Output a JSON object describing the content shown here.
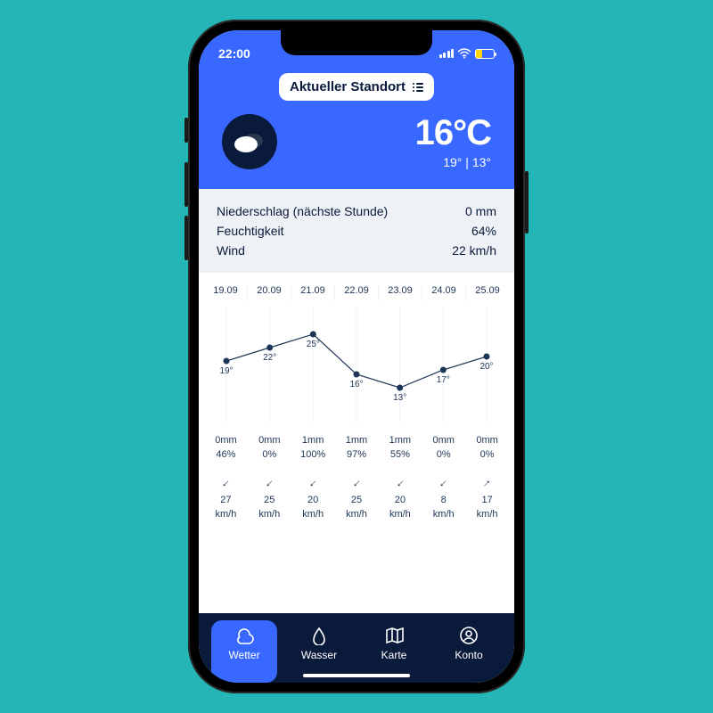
{
  "statusbar": {
    "time": "22:00"
  },
  "header": {
    "location_label": "Aktueller Standort",
    "temp": "16°C",
    "range": "19° | 13°"
  },
  "stats": {
    "rows": [
      {
        "label": "Niederschlag (nächste Stunde)",
        "value": "0 mm"
      },
      {
        "label": "Feuchtigkeit",
        "value": "64%"
      },
      {
        "label": "Wind",
        "value": "22 km/h"
      }
    ]
  },
  "chart_data": {
    "type": "line",
    "categories": [
      "19.09",
      "20.09",
      "21.09",
      "22.09",
      "23.09",
      "24.09",
      "25.09"
    ],
    "series": [
      {
        "name": "temp_high",
        "values": [
          19,
          22,
          25,
          16,
          13,
          17,
          20
        ],
        "labels": [
          "19°",
          "22°",
          "25°",
          "16°",
          "13°",
          "17°",
          "20°"
        ]
      }
    ],
    "ylim": [
      10,
      28
    ]
  },
  "forecast": {
    "precip_mm": [
      "0mm",
      "0mm",
      "1mm",
      "1mm",
      "1mm",
      "0mm",
      "0mm"
    ],
    "precip_pct": [
      "46%",
      "0%",
      "100%",
      "97%",
      "55%",
      "0%",
      "0%"
    ],
    "wind_dir_deg": [
      225,
      225,
      225,
      225,
      225,
      225,
      45
    ],
    "wind_speed": [
      "27",
      "25",
      "20",
      "25",
      "20",
      "8",
      "17"
    ],
    "wind_unit": "km/h"
  },
  "tabs": [
    {
      "id": "wetter",
      "label": "Wetter",
      "active": true
    },
    {
      "id": "wasser",
      "label": "Wasser",
      "active": false
    },
    {
      "id": "karte",
      "label": "Karte",
      "active": false
    },
    {
      "id": "konto",
      "label": "Konto",
      "active": false
    }
  ]
}
